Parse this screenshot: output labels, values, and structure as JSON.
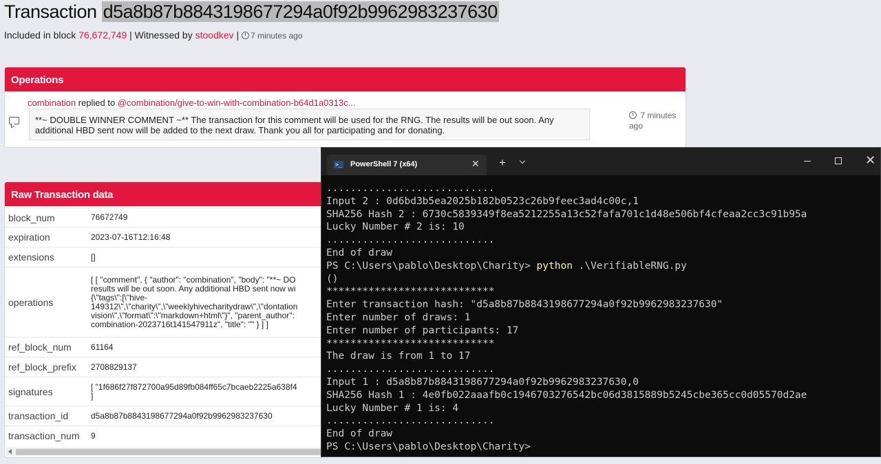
{
  "header": {
    "title_prefix": "Transaction",
    "tx_hash": "d5a8b87b8843198677294a0f92b9962983237630",
    "included_label": "Included in block",
    "block_number": "76,672,749",
    "sep1": " | Witnessed by ",
    "witness": "stoodkev",
    "sep2": " | ",
    "time_ago": "7 minutes ago"
  },
  "operations": {
    "heading": "Operations",
    "author": "combination",
    "replied_to_label": "replied to",
    "parent_link": "@combination/give-to-win-with-combination-b64d1a0313c...",
    "body": "**~ DOUBLE WINNER COMMENT ~** The transaction for this comment will be used for the RNG. The results will be out soon. Any additional HBD sent now will be added to the next draw. Thank you all for participating and for donating.",
    "time_ago": "7 minutes ago"
  },
  "raw": {
    "heading": "Raw Transaction data",
    "rows": [
      {
        "key": "block_num",
        "value": "76672749"
      },
      {
        "key": "expiration",
        "value": "2023-07-16T12:16:48"
      },
      {
        "key": "extensions",
        "value": "[]"
      },
      {
        "key": "operations",
        "lines": [
          "[ [ \"comment\", { \"author\": \"combination\", \"body\": \"**~ DO",
          "results will be out soon. Any additional HBD sent now wi",
          "{\\\"tags\\\":[\\\"hive-",
          "149312\\\",\\\"charity\\\",\\\"weeklyhivecharitydraw\\\",\\\"dontation",
          "vision\\\",\\\"format\\\":\\\"markdown+html\\\"}\", \"parent_author\":",
          "combination-2023716t141547911z\", \"title\": \"\" } ] ]"
        ]
      },
      {
        "key": "ref_block_num",
        "value": "61164"
      },
      {
        "key": "ref_block_prefix",
        "value": "2708829137"
      },
      {
        "key": "signatures",
        "lines": [
          "[ \"1f686f27f872700a95d89fb084ff65c7bcaeb2225a638f4",
          "]"
        ]
      },
      {
        "key": "transaction_id",
        "value": "d5a8b87b8843198677294a0f92b9962983237630"
      },
      {
        "key": "transaction_num",
        "value": "9"
      }
    ]
  },
  "terminal": {
    "tab_title": "PowerShell 7 (x64)",
    "lines": [
      {
        "text": "............................"
      },
      {
        "text": "Input 2 : 0d6bd3b5ea2025b182b0523c26b9feec3ad4c00c,1"
      },
      {
        "text": "SHA256 Hash 2 : 6730c5839349f8ea5212255a13c52fafa701c1d48e506bf4cfeaa2cc3c91b95a"
      },
      {
        "text": "Lucky Number # 2 is: 10"
      },
      {
        "text": "............................"
      },
      {
        "text": "End of draw"
      },
      {
        "text": "PS C:\\Users\\pablo\\Desktop\\Charity> ",
        "cmd": "python",
        "rest": " .\\VerifiableRNG.py"
      },
      {
        "text": "()"
      },
      {
        "text": "****************************"
      },
      {
        "text": "Enter transaction hash: \"d5a8b87b8843198677294a0f92b9962983237630\""
      },
      {
        "text": "Enter number of draws: 1"
      },
      {
        "text": "Enter number of participants: 17"
      },
      {
        "text": "****************************"
      },
      {
        "text": "The draw is from 1 to 17"
      },
      {
        "text": "............................"
      },
      {
        "text": "Input 1 : d5a8b87b8843198677294a0f92b9962983237630,0"
      },
      {
        "text": "SHA256 Hash 1 : 4e0fb022aaafb0c1946703276542bc06d3815889b5245cbe365cc0d05570d2ae"
      },
      {
        "text": "Lucky Number # 1 is: 4"
      },
      {
        "text": "............................"
      },
      {
        "text": "End of draw"
      },
      {
        "text": "PS C:\\Users\\pablo\\Desktop\\Charity>"
      }
    ]
  }
}
